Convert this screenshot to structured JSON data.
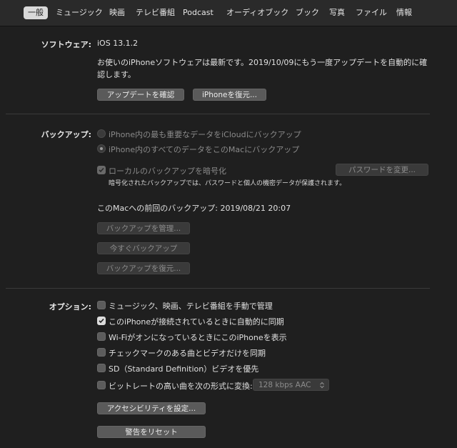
{
  "tabs": [
    "一般",
    "ミュージック",
    "映画",
    "テレビ番組",
    "Podcast",
    "オーディオブック",
    "ブック",
    "写真",
    "ファイル",
    "情報"
  ],
  "software": {
    "label": "ソフトウェア:",
    "version": "iOS 13.1.2",
    "message": "お使いのiPhoneソフトウェアは最新です。2019/10/09にもう一度アップデートを自動的に確認します。",
    "check_update_button": "アップデートを確認",
    "restore_button": "iPhoneを復元..."
  },
  "backup": {
    "label": "バックアップ:",
    "option_icloud": "iPhone内の最も重要なデータをiCloudにバックアップ",
    "option_mac": "iPhone内のすべてのデータをこのMacにバックアップ",
    "encrypt_label": "ローカルのバックアップを暗号化",
    "change_password_button": "パスワードを変更...",
    "encrypt_note": "暗号化されたバックアップでは、パスワードと個人の機密データが保護されます。",
    "last_backup": "このMacへの前回のバックアップ: 2019/08/21 20:07",
    "manage_button": "バックアップを管理...",
    "backup_now_button": "今すぐバックアップ",
    "restore_backup_button": "バックアップを復元..."
  },
  "options": {
    "label": "オプション:",
    "items": [
      {
        "label": "ミュージック、映画、テレビ番組を手動で管理",
        "checked": false
      },
      {
        "label": "このiPhoneが接続されているときに自動的に同期",
        "checked": true
      },
      {
        "label": "Wi-FiがオンになっているときにこのiPhoneを表示",
        "checked": false
      },
      {
        "label": "チェックマークのある曲とビデオだけを同期",
        "checked": false
      },
      {
        "label": "SD（Standard Definition）ビデオを優先",
        "checked": false
      },
      {
        "label": "ビットレートの高い曲を次の形式に変換:",
        "checked": false
      }
    ],
    "bitrate_value": "128 kbps AAC",
    "accessibility_button": "アクセシビリティを設定...",
    "reset_warnings_button": "警告をリセット"
  }
}
